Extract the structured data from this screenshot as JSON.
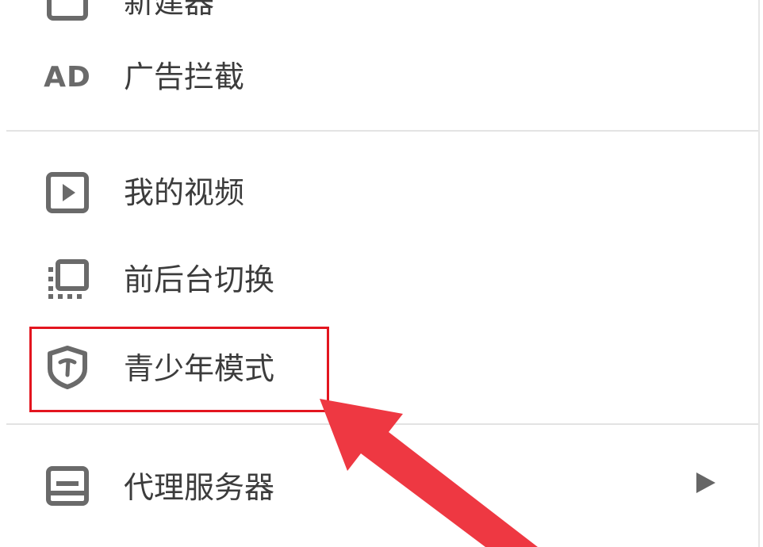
{
  "menu": {
    "items": [
      {
        "label": "新建器",
        "icon": "window-icon"
      },
      {
        "label": "广告拦截",
        "icon": "ad-icon",
        "icon_text": "AD"
      },
      {
        "label": "我的视频",
        "icon": "play-icon"
      },
      {
        "label": "前后台切换",
        "icon": "switch-icon"
      },
      {
        "label": "青少年模式",
        "icon": "shield-icon"
      },
      {
        "label": "代理服务器",
        "icon": "proxy-icon"
      }
    ]
  },
  "annotation": {
    "highlight_color": "#e3151f",
    "arrow_color": "#ee3842"
  }
}
